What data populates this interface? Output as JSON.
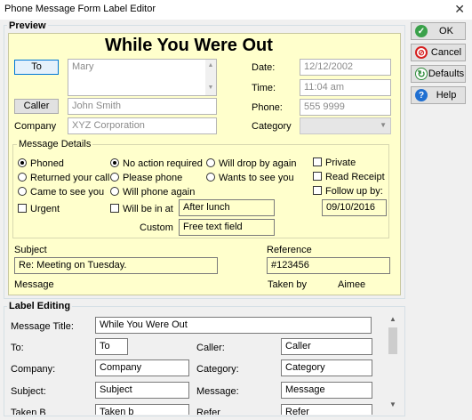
{
  "window": {
    "title": "Phone Message Form Label Editor",
    "close_glyph": "✕"
  },
  "side_buttons": {
    "ok": "OK",
    "cancel": "Cancel",
    "defaults": "Defaults",
    "help": "Help"
  },
  "preview": {
    "group_label": "Preview",
    "heading": "While You Were Out",
    "to_button": "To",
    "to_value": "Mary",
    "caller_button": "Caller",
    "caller_value": "John Smith",
    "company_label": "Company",
    "company_value": "XYZ Corporation",
    "date_label": "Date:",
    "date_value": "12/12/2002",
    "time_label": "Time:",
    "time_value": "11:04 am",
    "phone_label": "Phone:",
    "phone_value": "555 9999",
    "category_label": "Category",
    "category_value": "",
    "message_details": {
      "label": "Message Details",
      "phoned": "Phoned",
      "returned": "Returned your call",
      "came": "Came to see you",
      "urgent": "Urgent",
      "no_action": "No action required",
      "please_phone": "Please phone",
      "will_phone": "Will phone again",
      "will_be_in": "Will be in at",
      "will_be_in_value": "After lunch",
      "custom_label": "Custom",
      "custom_value": "Free text field",
      "drop_by": "Will drop by again",
      "wants_see": "Wants to see you",
      "private": "Private",
      "read_receipt": "Read Receipt",
      "follow_up": "Follow up by:",
      "follow_up_value": "09/10/2016"
    },
    "subject_label": "Subject",
    "subject_value": "Re: Meeting on Tuesday.",
    "reference_label": "Reference",
    "reference_value": "#123456",
    "message_label": "Message",
    "taken_by_label": "Taken by",
    "taken_by_value": "Aimee"
  },
  "label_editing": {
    "group_label": "Label Editing",
    "message_title_label": "Message Title:",
    "message_title_value": "While You Were Out",
    "to_label": "To:",
    "to_value": "To",
    "caller_label": "Caller:",
    "caller_value": "Caller",
    "company_label": "Company:",
    "company_value": "Company",
    "category_label": "Category:",
    "category_value": "Category",
    "subject_label": "Subject:",
    "subject_value": "Subject",
    "message_label": "Message:",
    "message_value": "Message",
    "partial_row": {
      "left_label": "Taken B",
      "left_value": "Taken b",
      "right_label": "Refer",
      "right_value": "Refer"
    }
  }
}
